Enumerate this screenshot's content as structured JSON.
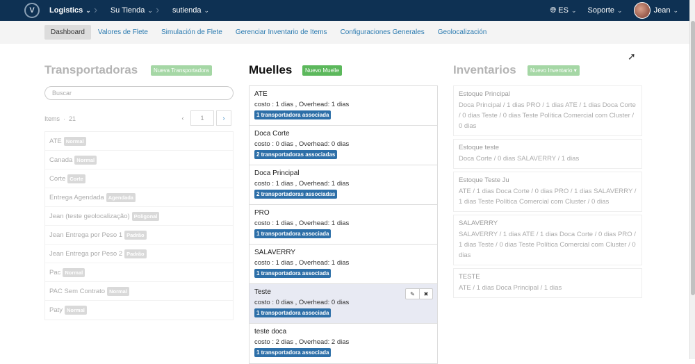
{
  "topbar": {
    "logo_letter": "V",
    "crumbs": [
      "Logistics",
      "Su Tienda",
      "sutienda"
    ],
    "language": "ES",
    "support": "Soporte",
    "user": "Jean"
  },
  "subnav": [
    "Dashboard",
    "Valores de Flete",
    "Simulación de Flete",
    "Gerenciar Inventario de Items",
    "Configuraciones Generales",
    "Geolocalización"
  ],
  "transportadoras": {
    "title": "Transportadoras",
    "new_button": "Nueva Transportadora",
    "search_placeholder": "Buscar",
    "items_label": "Items",
    "items_count": "21",
    "page_prev": "‹",
    "page": "1",
    "page_next": "›",
    "rows": [
      {
        "name": "ATE",
        "badge": "Normal"
      },
      {
        "name": "Canada",
        "badge": "Normal"
      },
      {
        "name": "Corte",
        "badge": "Corte"
      },
      {
        "name": "Entrega Agendada",
        "badge": "Agendada"
      },
      {
        "name": "Jean (teste geolocalização)",
        "badge": "Poligonal"
      },
      {
        "name": "Jean Entrega por Peso 1",
        "badge": "Padrão"
      },
      {
        "name": "Jean Entrega por Peso 2",
        "badge": "Padrão"
      },
      {
        "name": "Pac",
        "badge": "Normal"
      },
      {
        "name": "PAC Sem Contrato",
        "badge": "Normal"
      },
      {
        "name": "Paty",
        "badge": "Normal"
      }
    ]
  },
  "muelles": {
    "title": "Muelles",
    "new_button": "Nuevo Muelle",
    "rows": [
      {
        "name": "ATE",
        "cost": "costo : 1 dias , Overhead: 1 dias",
        "badge": "1 transportadora associada"
      },
      {
        "name": "Doca Corte",
        "cost": "costo : 0 dias , Overhead: 0 dias",
        "badge": "2 transportadoras associadas"
      },
      {
        "name": "Doca Principal",
        "cost": "costo : 1 dias , Overhead: 1 dias",
        "badge": "2 transportadoras associadas"
      },
      {
        "name": "PRO",
        "cost": "costo : 1 dias , Overhead: 1 dias",
        "badge": "1 transportadora associada"
      },
      {
        "name": "SALAVERRY",
        "cost": "costo : 1 dias , Overhead: 1 dias",
        "badge": "1 transportadora associada"
      },
      {
        "name": "Teste",
        "cost": "costo : 0 dias , Overhead: 0 dias",
        "badge": "1 transportadora associada"
      },
      {
        "name": "teste doca",
        "cost": "costo : 2 dias , Overhead: 2 dias",
        "badge": "1 transportadora associada"
      }
    ]
  },
  "inventarios": {
    "title": "Inventarios",
    "new_button": "Nuevo Inventario",
    "cards": [
      {
        "name": "Estoque Principal",
        "desc": "Doca Principal / 1 dias PRO / 1 dias ATE / 1 dias Doca Corte / 0 dias Teste / 0 dias Teste Política Comercial com Cluster / 0 dias"
      },
      {
        "name": "Estoque teste",
        "desc": "Doca Corte / 0 dias SALAVERRY / 1 dias"
      },
      {
        "name": "Estoque Teste Ju",
        "desc": "ATE / 1 dias Doca Corte / 0 dias PRO / 1 dias SALAVERRY / 1 dias Teste Política Comercial com Cluster / 0 dias"
      },
      {
        "name": "SALAVERRY",
        "desc": "SALAVERRY / 1 dias ATE / 1 dias Doca Corte / 0 dias PRO / 1 dias Teste / 0 dias Teste Política Comercial com Cluster / 0 dias"
      },
      {
        "name": "TESTE",
        "desc": "ATE / 1 dias Doca Principal / 1 dias"
      }
    ]
  }
}
